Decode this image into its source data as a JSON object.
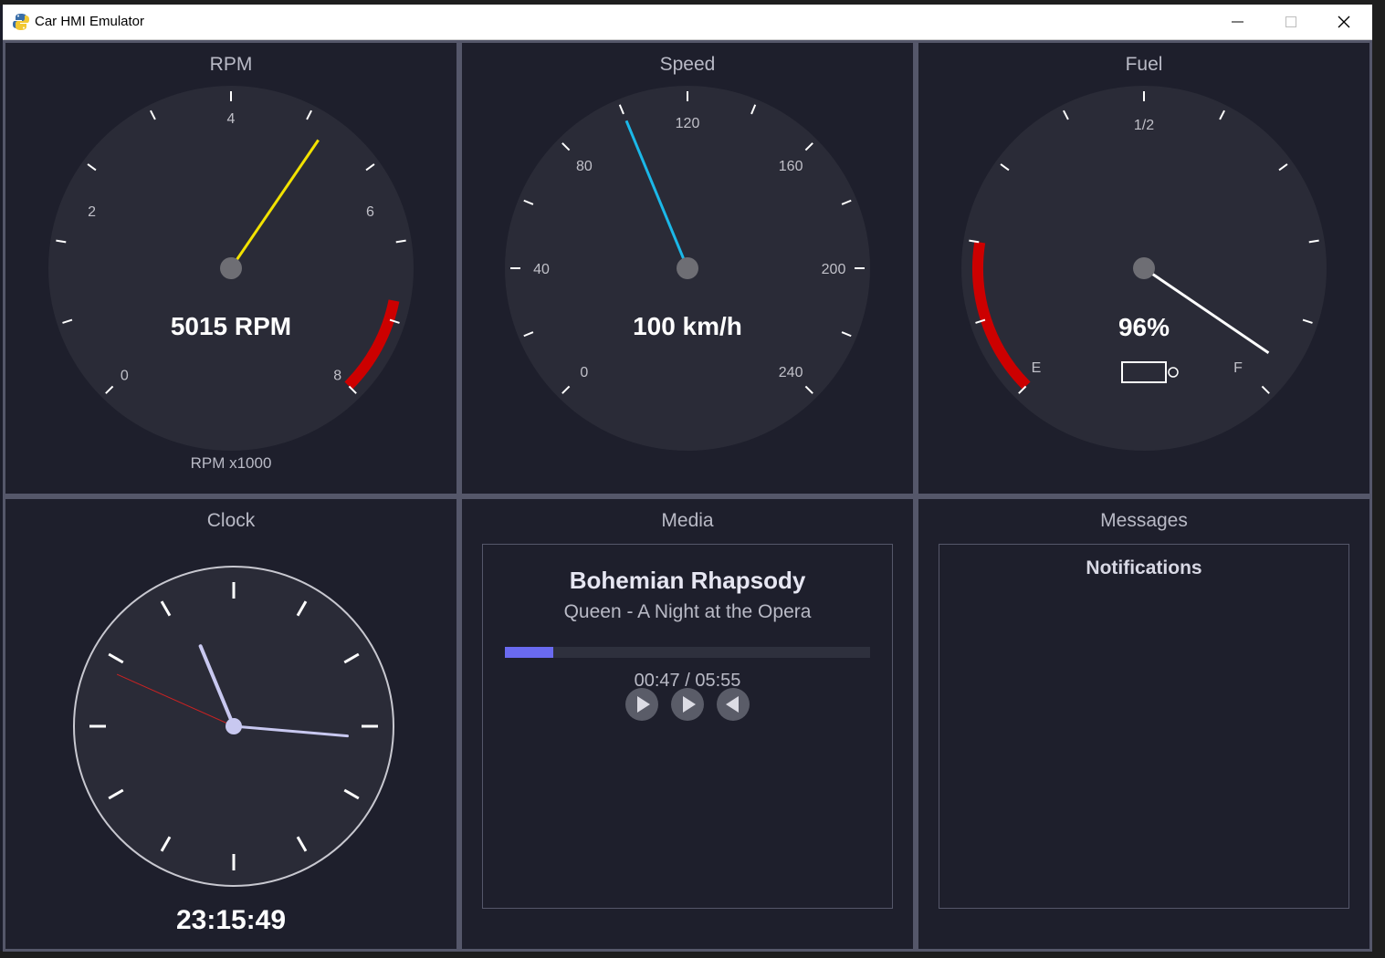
{
  "window": {
    "title": "Car HMI Emulator"
  },
  "colors": {
    "panel_bg": "#1e1f2c",
    "gauge_face": "#2a2b37",
    "panel_border": "#55576a",
    "rpm_needle": "#f2e200",
    "speed_needle": "#1bb8e8",
    "fuel_needle": "#ffffff",
    "redzone": "#cc0000",
    "progress_fill": "#6a6af0",
    "clock_hands": "#c8c8f0",
    "clock_second_hand": "#cc2222"
  },
  "rpm": {
    "title": "RPM",
    "value": 5015,
    "readout": "5015 RPM",
    "unit_label": "RPM x1000",
    "scale_min": 0,
    "scale_max": 8,
    "redline_start": 7,
    "tick_labels": [
      "0",
      "2",
      "4",
      "6",
      "8"
    ]
  },
  "speed": {
    "title": "Speed",
    "value": 100,
    "readout": "100 km/h",
    "scale_min": 0,
    "scale_max": 240,
    "tick_labels": [
      "0",
      "40",
      "80",
      "120",
      "160",
      "200",
      "240"
    ]
  },
  "fuel": {
    "title": "Fuel",
    "percent": 96,
    "readout": "96%",
    "low_warning_fraction": 0.2,
    "tick_labels": [
      "E",
      "1/2",
      "F"
    ],
    "icon": "fuel-pump-icon"
  },
  "clock": {
    "title": "Clock",
    "time": "23:15:49",
    "hours": 23,
    "minutes": 15,
    "seconds": 49
  },
  "media": {
    "title": "Media",
    "track": "Bohemian Rhapsody",
    "artist_album": "Queen - A Night at the Opera",
    "elapsed_seconds": 47,
    "duration_seconds": 355,
    "time_display": "00:47 / 05:55",
    "controls": [
      {
        "name": "play-button",
        "icon": "play-icon"
      },
      {
        "name": "next-button",
        "icon": "play-icon"
      },
      {
        "name": "previous-button",
        "icon": "rewind-icon"
      }
    ]
  },
  "messages": {
    "title": "Messages",
    "notifications_header": "Notifications",
    "items": []
  }
}
